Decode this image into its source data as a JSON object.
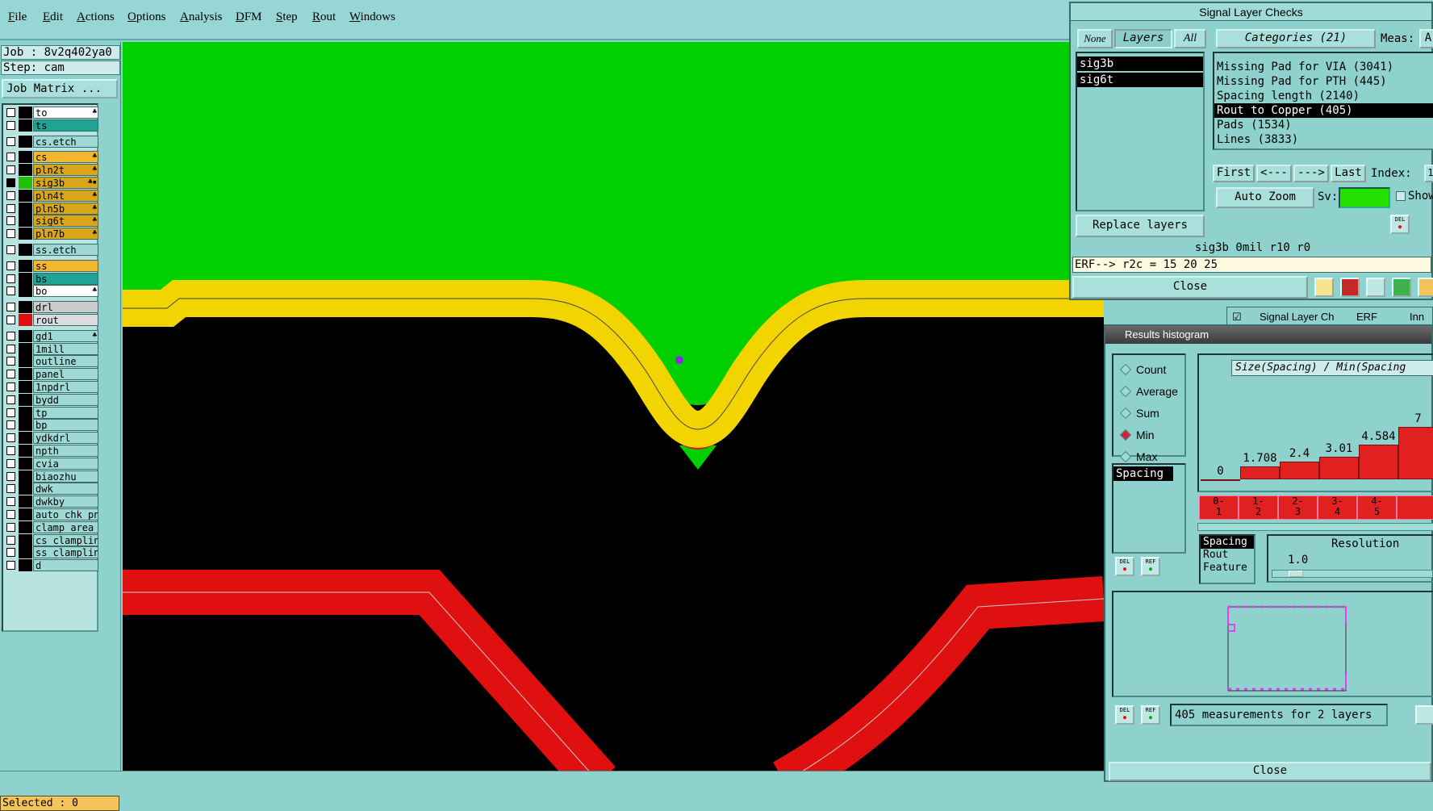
{
  "menu": [
    "File",
    "Edit",
    "Actions",
    "Options",
    "Analysis",
    "DFM",
    "Step",
    "Rout",
    "Windows"
  ],
  "job": {
    "job_label": "Job : 8v2q402ya0",
    "step_label": "Step: cam",
    "job_matrix": "Job Matrix ..."
  },
  "layers": [
    {
      "name": "to",
      "color": "#ffffff",
      "icon": "♣"
    },
    {
      "name": "ts",
      "color": "#1fa394",
      "icon": ""
    },
    {
      "name": "cs.etch",
      "color": "#9fd9d6",
      "icon": "",
      "gap": true
    },
    {
      "name": "cs",
      "color": "#f2b72f",
      "icon": "♣",
      "gap": true
    },
    {
      "name": "pln2t",
      "color": "#d9a519",
      "icon": "♣"
    },
    {
      "name": "sig3b",
      "color": "#d9a519",
      "icon": "♣▪",
      "active": true
    },
    {
      "name": "pln4t",
      "color": "#d9a519",
      "icon": "♣"
    },
    {
      "name": "pln5b",
      "color": "#d9a519",
      "icon": "♣"
    },
    {
      "name": "sig6t",
      "color": "#d9a519",
      "icon": "♣"
    },
    {
      "name": "pln7b",
      "color": "#d9a519",
      "icon": "♣"
    },
    {
      "name": "ss.etch",
      "color": "#9fd9d6",
      "icon": "",
      "gap": true
    },
    {
      "name": "ss",
      "color": "#f2b72f",
      "icon": "",
      "gap": true
    },
    {
      "name": "bs",
      "color": "#1fa394",
      "icon": ""
    },
    {
      "name": "bo",
      "color": "#ffffff",
      "icon": "♣"
    },
    {
      "name": "drl",
      "color": "#cccccc",
      "icon": "",
      "gap": true
    },
    {
      "name": "rout",
      "color": "#dddddd",
      "icon": "",
      "red": true
    },
    {
      "name": "gd1",
      "color": "#9fd9d6",
      "icon": "♣",
      "gap": true
    },
    {
      "name": "1mill",
      "color": "#9fd9d6",
      "icon": ""
    },
    {
      "name": "outline",
      "color": "#9fd9d6",
      "icon": ""
    },
    {
      "name": "panel",
      "color": "#9fd9d6",
      "icon": ""
    },
    {
      "name": "1npdrl",
      "color": "#9fd9d6",
      "icon": ""
    },
    {
      "name": "bydd",
      "color": "#9fd9d6",
      "icon": ""
    },
    {
      "name": "tp",
      "color": "#9fd9d6",
      "icon": ""
    },
    {
      "name": "bp",
      "color": "#9fd9d6",
      "icon": ""
    },
    {
      "name": "ydkdrl",
      "color": "#9fd9d6",
      "icon": ""
    },
    {
      "name": "npth",
      "color": "#9fd9d6",
      "icon": ""
    },
    {
      "name": "cvia",
      "color": "#9fd9d6",
      "icon": ""
    },
    {
      "name": "biaozhu",
      "color": "#9fd9d6",
      "icon": ""
    },
    {
      "name": "dwk",
      "color": "#9fd9d6",
      "icon": ""
    },
    {
      "name": "dwkby",
      "color": "#9fd9d6",
      "icon": ""
    },
    {
      "name": "auto_chk_pn",
      "color": "#9fd9d6",
      "icon": ""
    },
    {
      "name": "clamp_area",
      "color": "#9fd9d6",
      "icon": ""
    },
    {
      "name": "cs_clamplin",
      "color": "#9fd9d6",
      "icon": ""
    },
    {
      "name": "ss_clamplin",
      "color": "#9fd9d6",
      "icon": ""
    },
    {
      "name": "d",
      "color": "#9fd9d6",
      "icon": ""
    }
  ],
  "selected": "Selected : 0",
  "signal_checks": {
    "title": "Signal Layer Checks",
    "none_btn": "None",
    "layers_btn": "Layers",
    "all_btn": "All",
    "categories_btn": "Categories (21)",
    "meas_label": "Meas:",
    "meas_value": "A",
    "layer_items": [
      "sig3b",
      "sig6t"
    ],
    "categories": [
      "Missing Pad for VIA (3041)",
      "Missing Pad for PTH (445)",
      "Spacing length (2140)",
      "Rout to Copper (405)",
      "Pads (1534)",
      "Lines (3833)"
    ],
    "selected_category": "Rout to Copper (405)",
    "first_btn": "First",
    "prev_btn": "<---",
    "next_btn": "--->",
    "last_btn": "Last",
    "index_label": "Index:",
    "index_value": "1",
    "autozoom_btn": "Auto Zoom",
    "sv_label": "Sv:",
    "show_label": "Show",
    "replace_btn": "Replace layers",
    "status_line": "sig3b 0mil  r10  r0",
    "erf_line": "ERF--> r2c = 15 20 25",
    "close_btn": "Close",
    "del_label": "DEL",
    "ref_label": "REF"
  },
  "behind_window": {
    "title": "Signal Layer Ch",
    "erf": "ERF",
    "inn": "Inn"
  },
  "histogram": {
    "title": "Results histogram",
    "radios": [
      {
        "label": "Count",
        "on": false
      },
      {
        "label": "Average",
        "on": false
      },
      {
        "label": "Sum",
        "on": false
      },
      {
        "label": "Min",
        "on": true
      },
      {
        "label": "Max",
        "on": false
      }
    ],
    "attr_item": "Spacing",
    "header": "Size(Spacing) / Min(Spacing",
    "bars": [
      {
        "label": "0",
        "value": 0
      },
      {
        "label": "1.708",
        "value": 1.708
      },
      {
        "label": "2.4",
        "value": 2.4
      },
      {
        "label": "3.01",
        "value": 3.01
      },
      {
        "label": "4.584",
        "value": 4.584
      },
      {
        "label": "7",
        "value": 7
      }
    ],
    "bins": [
      "0-\n1",
      "1-\n2",
      "2-\n3",
      "3-\n4",
      "4-\n5",
      ""
    ],
    "type_items": [
      "Spacing",
      "Rout",
      "Feature"
    ],
    "resolution_label": "Resolution",
    "resolution_value": "1.0",
    "measurements": "405 measurements for 2 layers",
    "close_btn": "Close",
    "del_label": "DEL",
    "ref_label": "REF"
  }
}
